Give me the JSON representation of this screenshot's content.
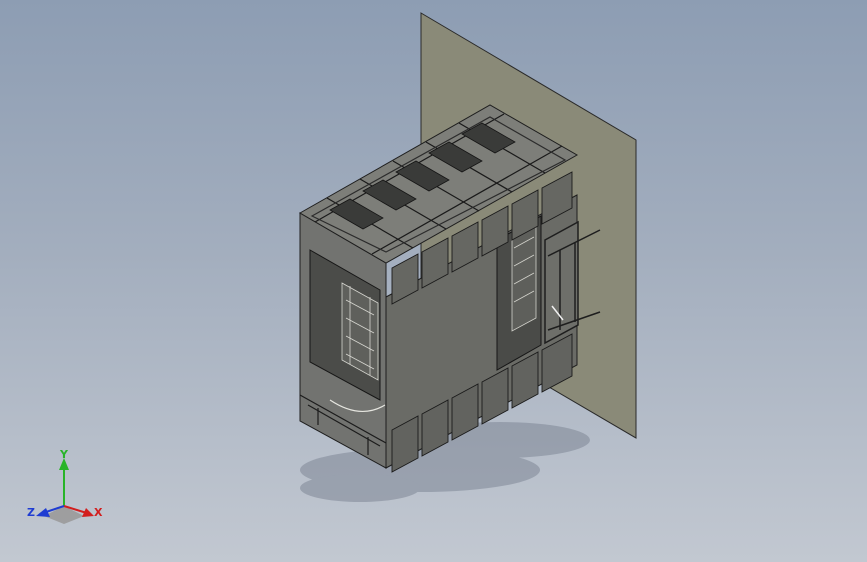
{
  "view": {
    "background_top": "#8d9db3",
    "background_bottom": "#c2c8d1",
    "model_face_color": "#6e6f69",
    "panel_color": "#8a8a78",
    "edge_color": "#1e1e1e"
  },
  "triad": {
    "x_label": "X",
    "y_label": "Y",
    "z_label": "Z",
    "x_color": "#d21e1e",
    "y_color": "#28b428",
    "z_color": "#1e3cd2"
  }
}
